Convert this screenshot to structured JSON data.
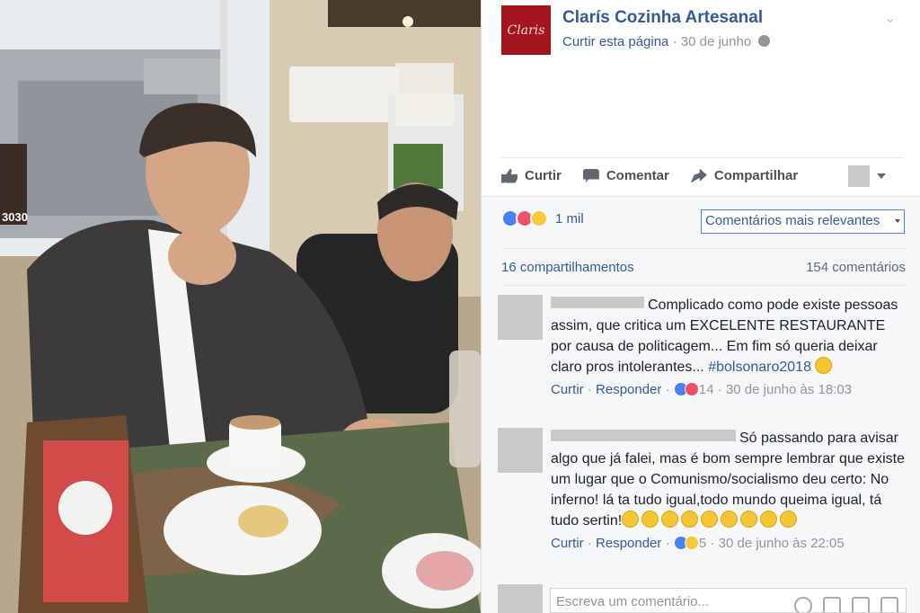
{
  "page": {
    "logo_text": "Claris",
    "name": "Clarís Cozinha Artesanal",
    "like_link": "Curtir esta página",
    "separator": "·",
    "date": "30 de junho"
  },
  "actions": {
    "like": "Curtir",
    "comment": "Comentar",
    "share": "Compartilhar"
  },
  "reactions": {
    "count": "1 mil",
    "sort_label": "Comentários mais relevantes"
  },
  "stats": {
    "shares": "16 compartilhamentos",
    "comments": "154 comentários"
  },
  "comments": [
    {
      "text": "Complicado como pode existe pessoas assim, que critica um EXCELENTE RESTAURANTE por causa de politicagem... Em fim só queria deixar claro pros intolerantes... ",
      "hashtag": "#bolsonaro2018",
      "like": "Curtir",
      "reply": "Responder",
      "reaction_count": "14",
      "timestamp": "30 de junho às 18:03"
    },
    {
      "text": "Só passando para avisar algo que já falei, mas é bom sempre lembrar que existe um lugar que o Comunismo/socialismo deu certo: No inferno! lá ta tudo igual,todo mundo queima igual, tá tudo sertin!",
      "like": "Curtir",
      "reply": "Responder",
      "reaction_count": "5",
      "timestamp": "30 de junho às 22:05"
    }
  ],
  "write_placeholder": "Escreva um comentário...",
  "photo": {
    "price_sign": "3030"
  },
  "colors": {
    "fb_blue": "#365899",
    "logo_red": "#a3141c",
    "like_blue": "#4a80f5"
  }
}
